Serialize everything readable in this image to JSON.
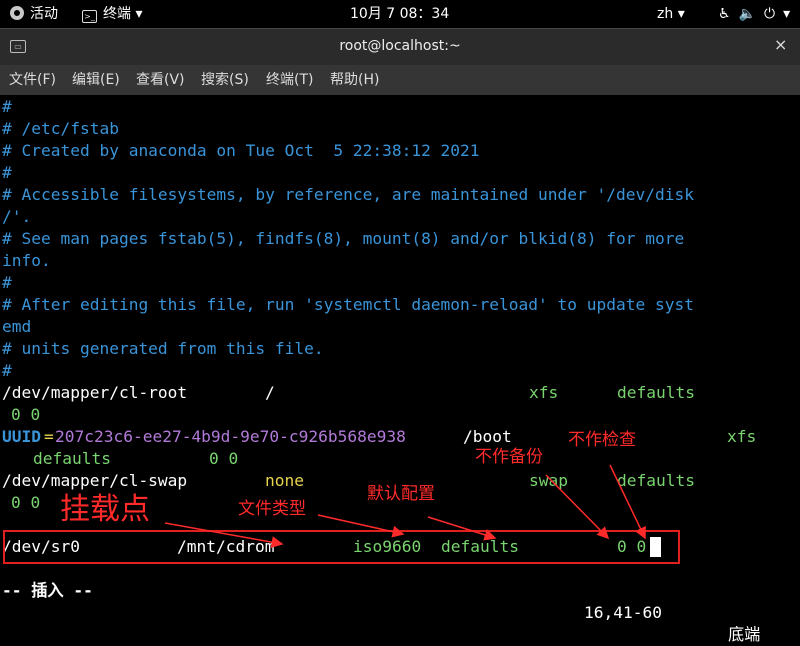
{
  "topbar": {
    "activities": "活动",
    "app_menu": "终端",
    "clock": "10月 7 08：34",
    "lang": "zh",
    "icons": [
      "accessibility-icon",
      "volume-icon",
      "power-icon"
    ]
  },
  "window": {
    "title": "root@localhost:~",
    "close": "×"
  },
  "menu": [
    "文件(F)",
    "编辑(E)",
    "查看(V)",
    "搜索(S)",
    "终端(T)",
    "帮助(H)"
  ],
  "terminal": {
    "comments": [
      "#",
      "# /etc/fstab",
      "# Created by anaconda on Tue Oct  5 22:38:12 2021",
      "#",
      "# Accessible filesystems, by reference, are maintained under '/dev/disk",
      "/'.",
      "# See man pages fstab(5), findfs(8), mount(8) and/or blkid(8) for more",
      "info.",
      "#",
      "# After editing this file, run 'systemctl daemon-reload' to update syst",
      "emd",
      "# units generated from this file.",
      "#"
    ],
    "root": {
      "device": "/dev/mapper/cl-root",
      "mount": "/",
      "type": "xfs",
      "options": "defaults",
      "dump": "0 0"
    },
    "boot": {
      "uuid_key": "UUID",
      "eq": "=",
      "uuid": "207c23c6-ee27-4b9d-9e70-c926b568e938",
      "mount": "/boot",
      "type": "xfs",
      "options": "defaults",
      "dump": "0 0"
    },
    "swap": {
      "device": "/dev/mapper/cl-swap",
      "mount": "none",
      "type": "swap",
      "options": "defaults",
      "dump": "0 0"
    },
    "sr0": {
      "device": "/dev/sr0",
      "mount": "/mnt/cdrom",
      "type": "iso9660",
      "options": "defaults",
      "dump": "0 0"
    },
    "status": {
      "mode": "-- 插入 --",
      "position": "16,41-60",
      "scroll": "底端"
    }
  },
  "colors": {
    "comment": "#3a94d8",
    "type": "#7ad46f",
    "none": "#e8d44d",
    "uuid": "#b27ad8",
    "annotation": "#ff2a2a"
  },
  "annotations": {
    "mount_point": "挂载点",
    "fs_type": "文件类型",
    "default_config": "默认配置",
    "no_backup": "不作备份",
    "no_check": "不作检查"
  }
}
